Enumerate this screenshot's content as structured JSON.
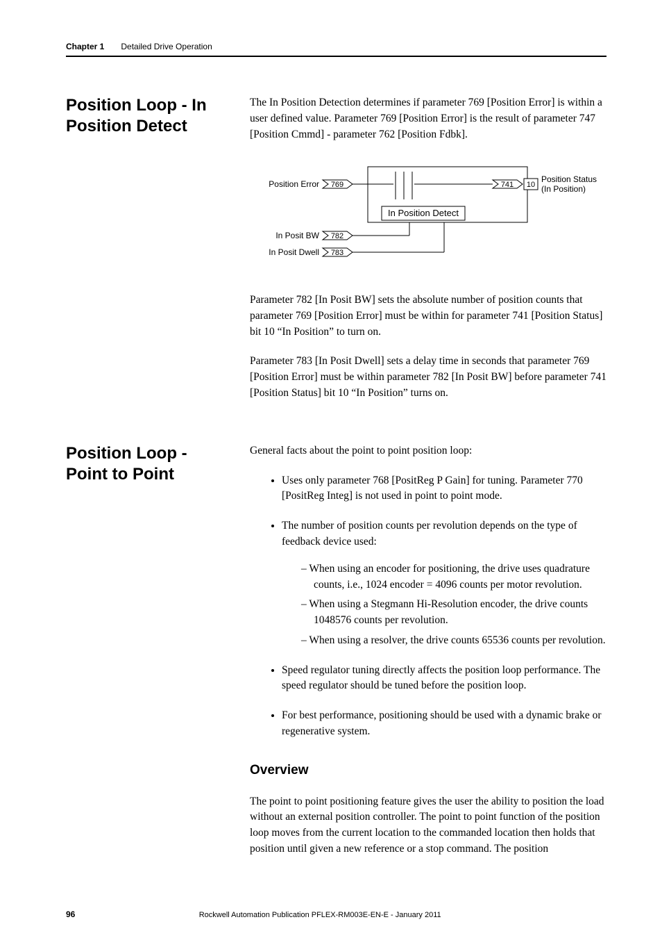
{
  "header": {
    "chapter": "Chapter 1",
    "title": "Detailed Drive Operation"
  },
  "section1": {
    "heading": "Position Loop - In Position Detect",
    "p1": "The In Position Detection determines if parameter 769 [Position Error] is within a user defined value. Parameter 769 [Position Error] is the result of parameter 747 [Position Cmmd] - parameter 762 [Position Fdbk].",
    "p2": "Parameter 782 [In Posit BW] sets the absolute number of position counts that parameter 769 [Position Error] must be within for parameter 741 [Position Status] bit 10 “In Position” to turn on.",
    "p3": "Parameter 783 [In Posit Dwell] sets a delay time in seconds that parameter 769 [Position Error] must be within parameter 782 [In Posit BW] before parameter 741 [Position Status] bit 10 “In Position” turns on."
  },
  "diagram": {
    "in1": "Position Error",
    "p769": "769",
    "block": "In Position Detect",
    "in2": "In Posit BW",
    "p782": "782",
    "in3": "In Posit Dwell",
    "p783": "783",
    "p741": "741",
    "bit10": "10",
    "out1a": "Position Status",
    "out1b": "(In Position)"
  },
  "section2": {
    "heading": "Position Loop - Point to Point",
    "intro": "General facts about the point to point position loop:",
    "b1": "Uses only parameter 768 [PositReg P Gain] for tuning. Parameter 770 [PositReg Integ] is not used in point to point mode.",
    "b2": "The number of position counts per revolution depends on the type of feedback device used:",
    "b2a": "When using an encoder for positioning, the drive uses quadrature counts, i.e., 1024 encoder = 4096 counts per motor revolution.",
    "b2b": "When using a Stegmann Hi-Resolution encoder, the drive counts 1048576 counts per revolution.",
    "b2c": "When using a resolver, the drive counts 65536 counts per revolution.",
    "b3": "Speed regulator tuning directly affects the position loop performance. The speed regulator should be tuned before the position loop.",
    "b4": "For best performance, positioning should be used with a dynamic brake or regenerative system.",
    "sub": "Overview",
    "p_overview": "The point to point positioning feature gives the user the ability to position the load without an external position controller. The point to point function of the position loop moves from the current location to the commanded location then holds that position until given a new reference or a stop command. The position"
  },
  "footer": {
    "page": "96",
    "pub": "Rockwell Automation Publication PFLEX-RM003E-EN-E - January 2011"
  }
}
